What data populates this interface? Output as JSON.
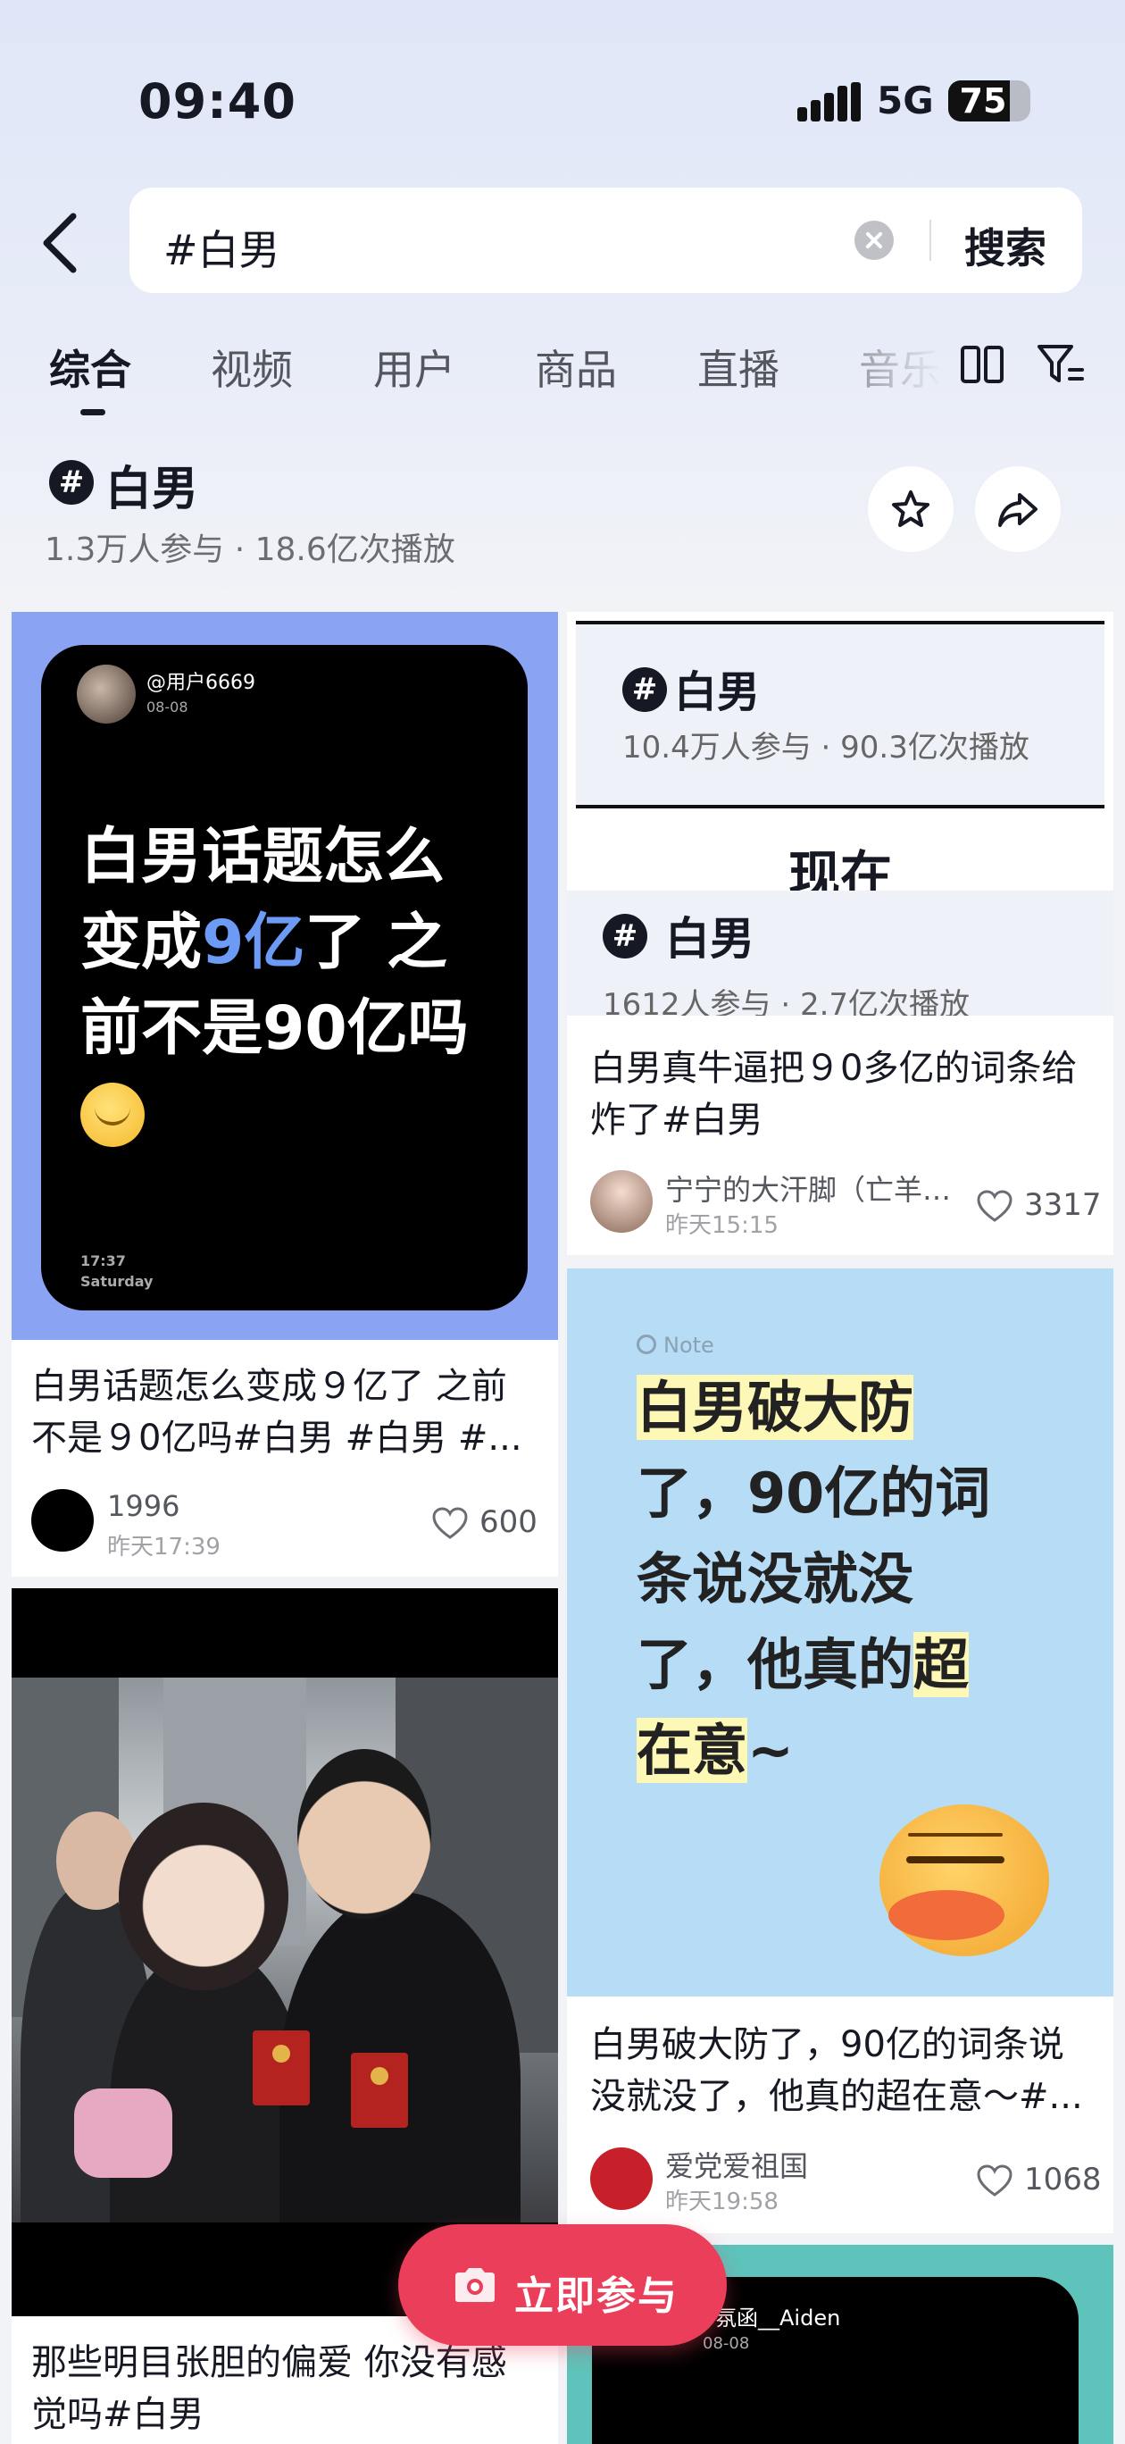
{
  "status_bar": {
    "time": "09:40",
    "network": "5G",
    "battery": "75",
    "battery_level": 0.75
  },
  "search": {
    "query": "#白男",
    "button_label": "搜索"
  },
  "tabs": [
    "综合",
    "视频",
    "用户",
    "商品",
    "直播",
    "音乐"
  ],
  "active_tab": "综合",
  "topic": {
    "title": "白男",
    "stats": "1.3万人参与 · 18.6亿次播放"
  },
  "feed": {
    "card1": {
      "image": {
        "username": "@用户6669",
        "date": "08-08",
        "line1": "白男话题怎么",
        "line2_pre": "变成",
        "line2_highlight": "9亿",
        "line2_post": "了 之",
        "line3": "前不是90亿吗",
        "clock": "17:37",
        "day": "Saturday"
      },
      "title": "白男话题怎么变成９亿了 之前不是９0亿吗#白男 #白男 #...",
      "author": "1996",
      "time": "昨天17:39",
      "likes": "600"
    },
    "card2": {
      "image": {
        "old_title": "白男",
        "old_stats": "10.4万人参与 · 90.3亿次播放",
        "now_label": "现在",
        "new_title": "白男",
        "new_stats": "1612人参与 · 2.7亿次播放"
      },
      "title": "白男真牛逼把９0多亿的词条给炸了#白男",
      "author": "宁宁的大汗脚（亡羊…",
      "time": "昨天15:15",
      "likes": "3317"
    },
    "card3": {
      "image": {
        "note_label": "Note",
        "line1": "白男破大防",
        "line2": "了，90亿的词",
        "line3": "条说没就没",
        "line4_pre": "了，他真的",
        "line4_highlight": "超",
        "line5_highlight": "在意",
        "line5_post": "~"
      },
      "title": "白男破大防了，90亿的词条说没就没了，他真的超在意～#...",
      "author": "爱党爱祖国",
      "time": "昨天19:58",
      "likes": "1068"
    },
    "card4": {
      "title": "那些明目张胆的偏爱 你没有感觉吗#白男"
    },
    "card5": {
      "image": {
        "username": "氛函__Aiden",
        "date": "08-08"
      }
    }
  },
  "join_button": {
    "label": "立即参与"
  },
  "colors": {
    "accent": "#ea3e5a",
    "highlight_blue": "#6c9bf6",
    "card1_bg": "#8aa3f3",
    "card3_bg": "#b6dcf6",
    "card5_bg": "#5ec3ba"
  },
  "icons": [
    "back-icon",
    "clear-icon",
    "layout-icon",
    "filter-icon",
    "hashtag-icon",
    "star-icon",
    "share-icon",
    "heart-icon",
    "camera-icon"
  ]
}
